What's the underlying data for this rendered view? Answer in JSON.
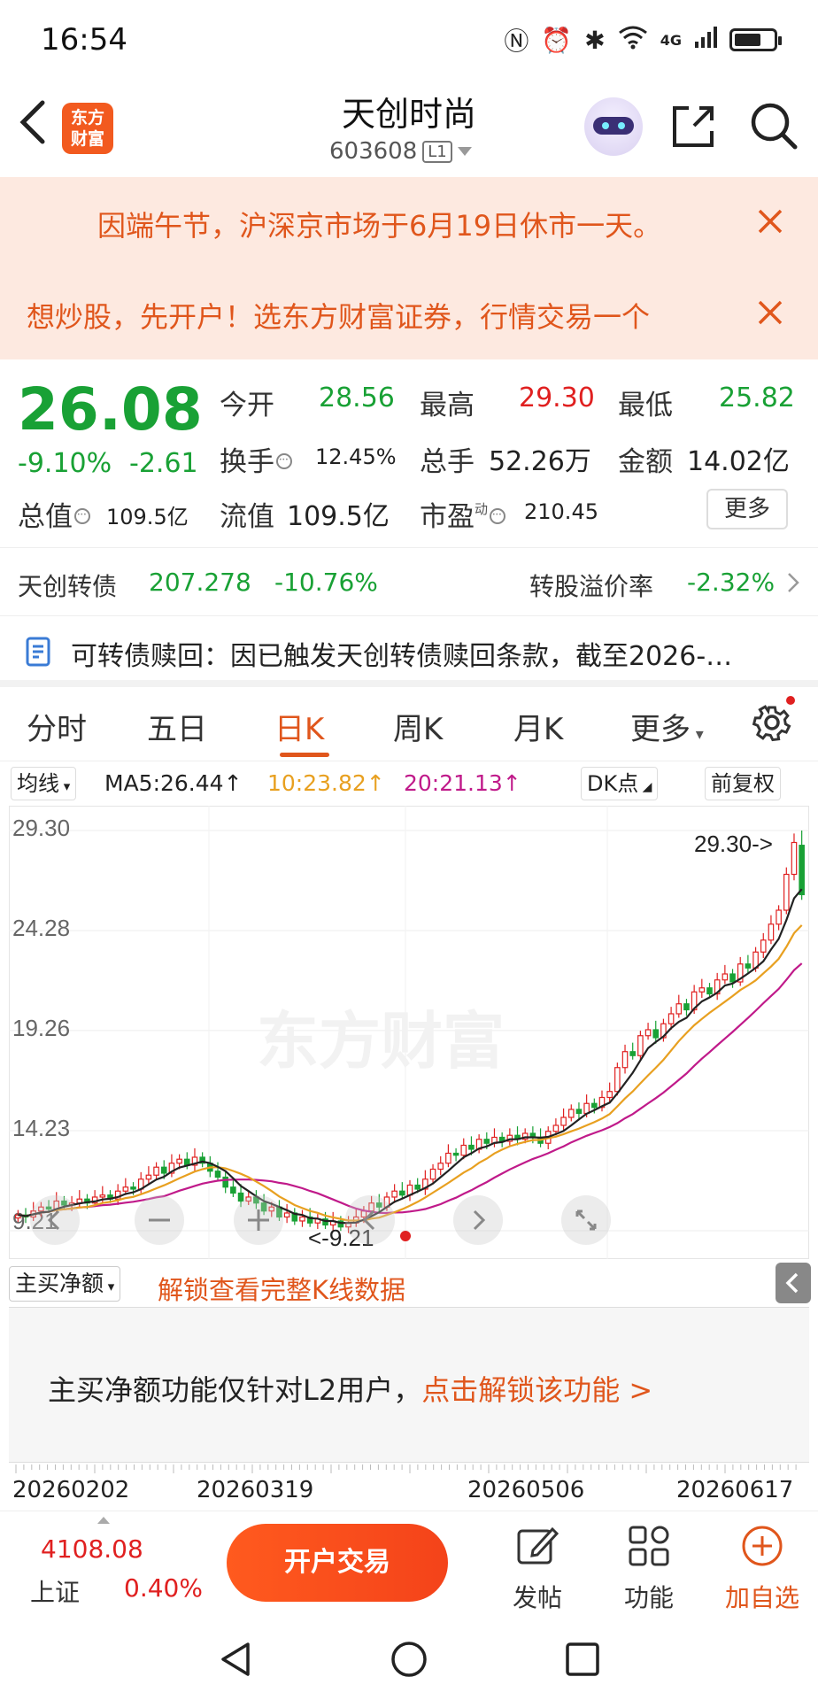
{
  "status_bar": {
    "time": "16:54",
    "network": "4G"
  },
  "header": {
    "logo_line1": "东方",
    "logo_line2": "财富",
    "stock_name": "天创时尚",
    "stock_code": "603608",
    "level_badge": "L1"
  },
  "notices": [
    {
      "text": "因端午节，沪深京市场于6月19日休市一天。"
    },
    {
      "text": "想炒股，先开户！选东方财富证券，行情交易一个"
    }
  ],
  "quote": {
    "price": "26.08",
    "change_pct": "-9.10%",
    "change": "-2.61",
    "open_label": "今开",
    "open": "28.56",
    "high_label": "最高",
    "high": "29.30",
    "low_label": "最低",
    "low": "25.82",
    "turnover_label": "换手",
    "turnover": "12.45%",
    "volume_label": "总手",
    "volume": "52.26万",
    "amount_label": "金额",
    "amount": "14.02亿",
    "mktcap_label": "总值",
    "mktcap": "109.5亿",
    "float_label": "流值",
    "float": "109.5亿",
    "pe_label": "市盈",
    "pe_sup": "动",
    "pe": "210.45",
    "more_label": "更多"
  },
  "bond": {
    "name": "天创转债",
    "price": "207.278",
    "pct": "-10.76%",
    "premium_label": "转股溢价率",
    "premium": "-2.32%"
  },
  "news": {
    "text": "可转债赎回：因已触发天创转债赎回条款，截至2026-…"
  },
  "tabs": [
    {
      "label": "分时"
    },
    {
      "label": "五日"
    },
    {
      "label": "日K"
    },
    {
      "label": "周K"
    },
    {
      "label": "月K"
    },
    {
      "label": "更多"
    }
  ],
  "ma": {
    "selector": "均线",
    "ma5": "MA5:26.44↑",
    "ma10": "10:23.82↑",
    "ma20": "20:21.13↑",
    "dk": "DK点",
    "adjust": "前复权",
    "colors": {
      "ma5": "#222222",
      "ma10": "#e8a020",
      "ma20": "#c01a8a"
    }
  },
  "watermark": "东方财富",
  "chart_data": {
    "type": "candlestick",
    "y_ticks": [
      "29.30",
      "24.28",
      "19.26",
      "14.23",
      "9.21"
    ],
    "ylim": [
      9.21,
      29.3
    ],
    "high_label": "29.30->",
    "low_label": "<-9.21",
    "up_color": "#e02020",
    "down_color": "#19a135",
    "close": [
      10.0,
      9.9,
      10.2,
      10.4,
      10.3,
      10.7,
      10.5,
      10.6,
      10.8,
      10.6,
      10.9,
      11.0,
      10.8,
      11.2,
      11.4,
      11.3,
      11.8,
      12.0,
      12.4,
      12.1,
      12.6,
      12.8,
      12.5,
      12.9,
      12.6,
      12.2,
      11.9,
      11.4,
      11.1,
      10.7,
      10.9,
      10.6,
      10.2,
      10.4,
      9.9,
      10.1,
      9.7,
      9.9,
      9.6,
      9.8,
      9.5,
      9.7,
      9.4,
      9.6,
      9.9,
      10.2,
      10.6,
      10.4,
      10.9,
      11.2,
      11.0,
      11.5,
      11.3,
      11.8,
      12.3,
      12.6,
      13.1,
      13.0,
      13.5,
      13.3,
      13.8,
      13.6,
      13.9,
      13.7,
      14.0,
      13.8,
      14.1,
      13.9,
      13.6,
      14.2,
      14.5,
      14.9,
      15.3,
      15.1,
      15.6,
      15.4,
      15.9,
      16.2,
      17.4,
      18.2,
      18.0,
      19.0,
      19.3,
      18.9,
      19.6,
      20.1,
      20.6,
      20.3,
      21.2,
      21.4,
      21.1,
      21.8,
      22.1,
      21.7,
      22.6,
      22.4,
      23.2,
      23.8,
      24.6,
      25.3,
      27.1,
      28.7,
      26.08
    ],
    "dates": [
      "20260202",
      "20260319",
      "20260506",
      "20260617"
    ]
  },
  "indicator": {
    "selector": "主买净额",
    "unlock": "解锁查看完整K线数据",
    "panel_text": "主买净额功能仅针对L2用户，",
    "panel_link": "点击解锁该功能 >"
  },
  "bottom_bar": {
    "index_value": "4108.08",
    "index_name": "上证",
    "index_pct": "0.40%",
    "open_account": "开户交易",
    "post": "发帖",
    "function": "功能",
    "add_watch": "加自选"
  }
}
